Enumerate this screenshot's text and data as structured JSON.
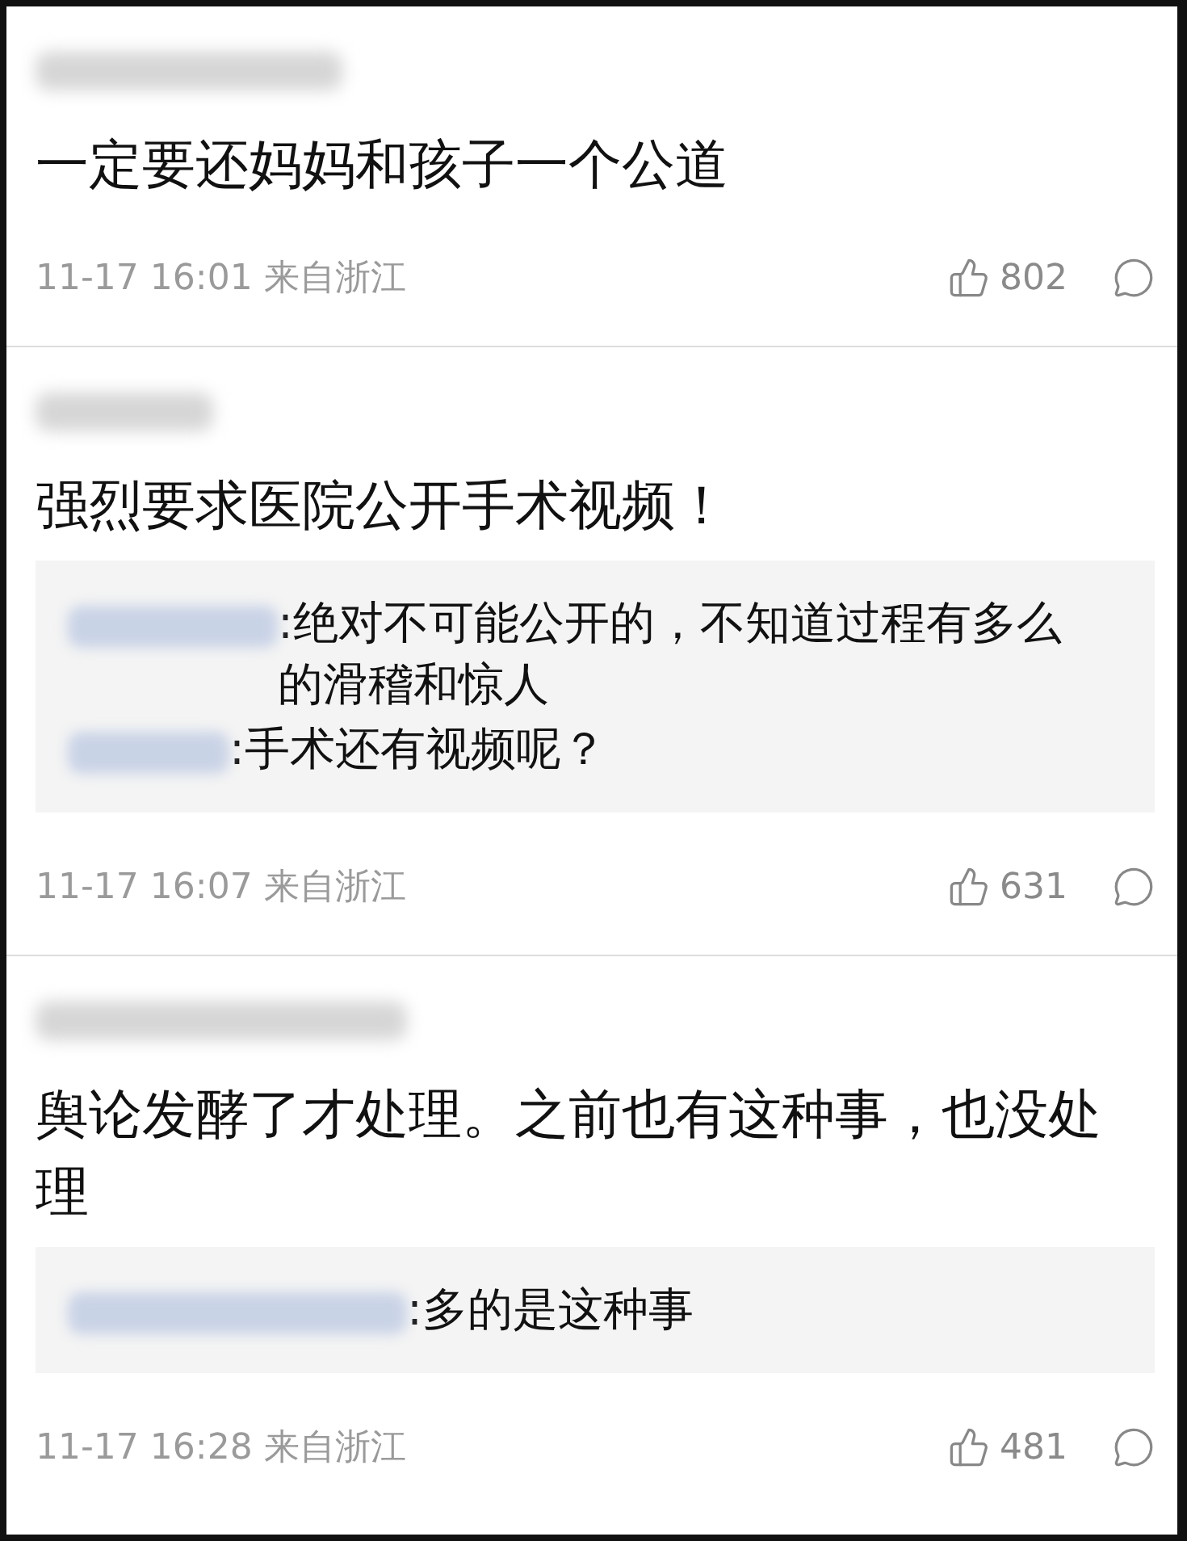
{
  "comments": [
    {
      "text": "一定要还妈妈和孩子一个公道",
      "time": "11-17 16:01 来自浙江",
      "likes": "802"
    },
    {
      "text": "强烈要求医院公开手术视频！",
      "replies": [
        {
          "text": ":绝对不可能公开的，不知道过程有多么的滑稽和惊人"
        },
        {
          "text": ":手术还有视频呢？"
        }
      ],
      "time": "11-17 16:07 来自浙江",
      "likes": "631"
    },
    {
      "text": "舆论发酵了才处理。之前也有这种事，也没处理",
      "replies": [
        {
          "text": ":多的是这种事"
        }
      ],
      "time": "11-17 16:28 来自浙江",
      "likes": "481"
    }
  ]
}
